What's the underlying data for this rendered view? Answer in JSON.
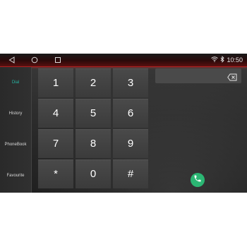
{
  "status_bar": {
    "nav_icons": [
      "back-icon",
      "home-icon",
      "recents-icon"
    ],
    "wifi_icon": "wifi-icon",
    "bluetooth_icon": "bluetooth-icon",
    "time": "10:50"
  },
  "sidebar": {
    "items": [
      {
        "label": "Dial",
        "active": true
      },
      {
        "label": "History",
        "active": false
      },
      {
        "label": "PhoneBook",
        "active": false
      },
      {
        "label": "Favourite",
        "active": false
      }
    ]
  },
  "keypad": {
    "keys": [
      "1",
      "2",
      "3",
      "4",
      "5",
      "6",
      "7",
      "8",
      "9",
      "*",
      "0",
      "#"
    ]
  },
  "number_display": {
    "value": "",
    "backspace_icon": "backspace-icon"
  },
  "call_button": {
    "icon": "phone-icon",
    "color": "#2bb673"
  },
  "colors": {
    "accent": "#27b6a4",
    "statusbar_glow": "#b02020"
  }
}
